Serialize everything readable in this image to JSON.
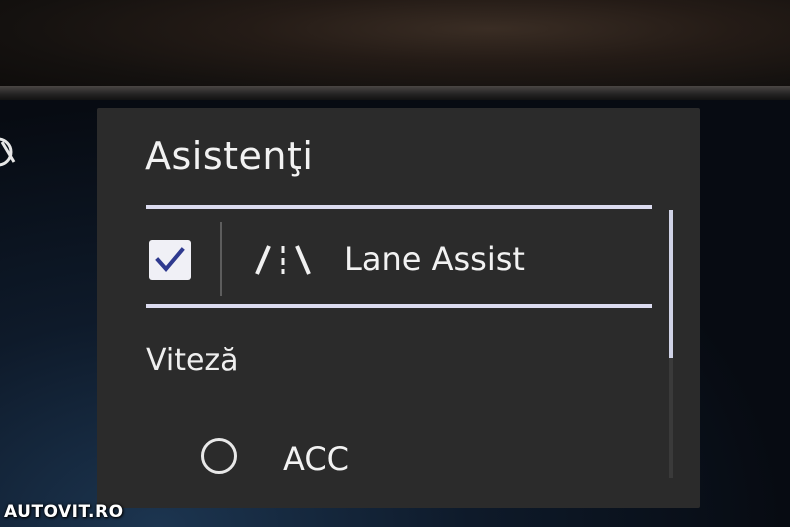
{
  "panel": {
    "title": "Asistenţi"
  },
  "lane_assist": {
    "label": "Lane Assist",
    "checked": true,
    "icon": "lane-assist-icon"
  },
  "speed_section": {
    "label": "Viteză"
  },
  "acc": {
    "label": "ACC",
    "selected": false
  },
  "watermark": {
    "text": "AUTOVIT.RO"
  },
  "colors": {
    "panel_bg": "#2b2b2b",
    "accent": "#dcdcf0",
    "checkmark": "#2f3a8f",
    "text": "#f2f2f2"
  }
}
